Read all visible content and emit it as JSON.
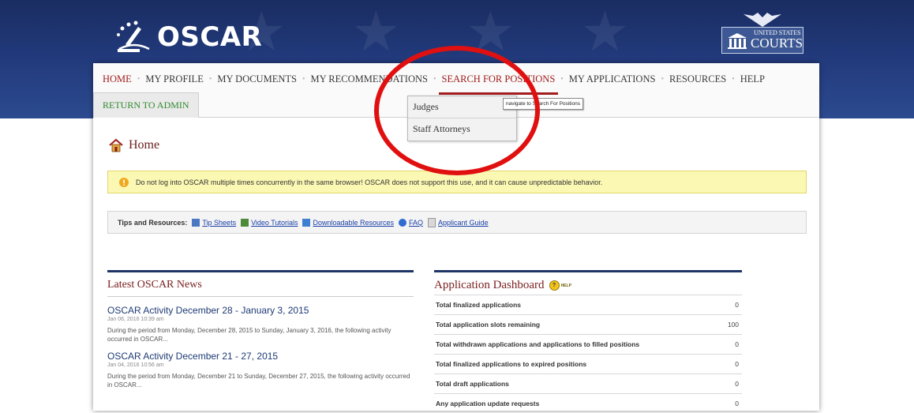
{
  "banner": {
    "app_name": "OSCAR",
    "courts_line1": "UNITED STATES",
    "courts_line2": "COURTS"
  },
  "nav": {
    "items": [
      "HOME",
      "MY PROFILE",
      "MY DOCUMENTS",
      "MY RECOMMENDATIONS",
      "SEARCH FOR POSITIONS",
      "MY APPLICATIONS",
      "RESOURCES",
      "HELP"
    ],
    "return_label": "RETURN TO ADMIN",
    "dropdown": [
      "Judges",
      "Staff Attorneys"
    ],
    "tooltip": "navigate to Search For Positions"
  },
  "page": {
    "title": "Home",
    "warning": "Do not log into OSCAR multiple times concurrently in the same browser! OSCAR does not support this use, and it can cause unpredictable behavior.",
    "tips_label": "Tips and Resources:",
    "tips": [
      "Tip Sheets",
      "Video Tutorials",
      "Downloadable Resources",
      "FAQ",
      "Applicant Guide"
    ]
  },
  "news": {
    "title": "Latest OSCAR News",
    "items": [
      {
        "headline": "OSCAR Activity December 28 - January 3, 2015",
        "date": "Jan 06, 2016 10:39 am",
        "body": "During the period from Monday, December 28, 2015 to Sunday, January 3, 2016, the following activity occurred in OSCAR..."
      },
      {
        "headline": "OSCAR Activity December 21 - 27, 2015",
        "date": "Jan 04, 2016 10:56 am",
        "body": "During the period from Monday, December 21 to Sunday, December 27, 2015, the following activity occurred in OSCAR..."
      }
    ]
  },
  "dashboard": {
    "title": "Application Dashboard",
    "help": "HELP",
    "rows": [
      {
        "label": "Total finalized applications",
        "value": "0"
      },
      {
        "label": "Total application slots remaining",
        "value": "100"
      },
      {
        "label": "Total withdrawn applications and applications to filled positions",
        "value": "0"
      },
      {
        "label": "Total finalized applications to expired positions",
        "value": "0"
      },
      {
        "label": "Total draft applications",
        "value": "0"
      },
      {
        "label": "Any application update requests",
        "value": "0"
      }
    ]
  },
  "colors": {
    "banner": "#21397a",
    "nav_active": "#a11d1d",
    "annotation_circle": "#e11010",
    "warning_bg": "#fbf8b3"
  }
}
